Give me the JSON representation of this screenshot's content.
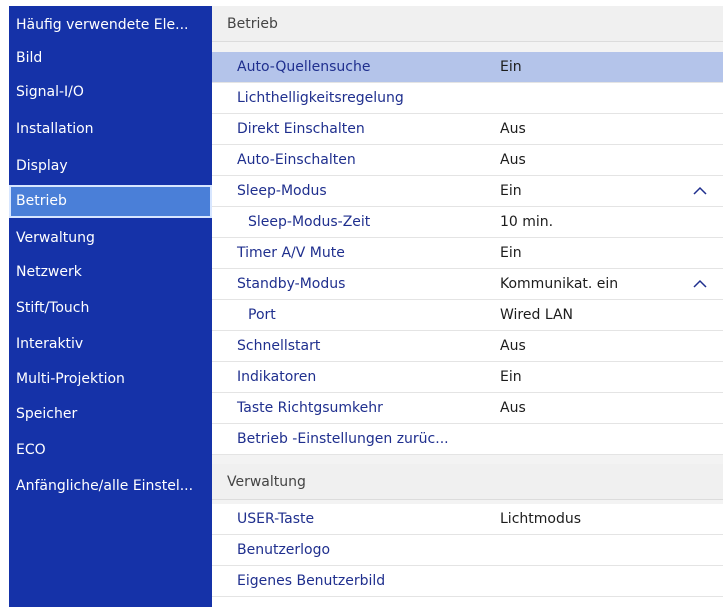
{
  "sidebar": {
    "items": [
      {
        "label": "Häufig verwendete Ele...",
        "selected": false
      },
      {
        "label": "Bild",
        "selected": false
      },
      {
        "label": "Signal-I/O",
        "selected": false
      },
      {
        "label": "Installation",
        "selected": false
      },
      {
        "label": "Display",
        "selected": false
      },
      {
        "label": "Betrieb",
        "selected": true
      },
      {
        "label": "Verwaltung",
        "selected": false
      },
      {
        "label": "Netzwerk",
        "selected": false
      },
      {
        "label": "Stift/Touch",
        "selected": false
      },
      {
        "label": "Interaktiv",
        "selected": false
      },
      {
        "label": "Multi-Projektion",
        "selected": false
      },
      {
        "label": "Speicher",
        "selected": false
      },
      {
        "label": "ECO",
        "selected": false
      },
      {
        "label": "Anfängliche/alle Einstel...",
        "selected": false
      }
    ]
  },
  "sections": {
    "betrieb": {
      "title": "Betrieb",
      "rows": [
        {
          "label": "Auto-Quellensuche",
          "value": "Ein",
          "highlighted": true
        },
        {
          "label": "Lichthelligkeitsregelung",
          "value": ""
        },
        {
          "label": "Direkt Einschalten",
          "value": "Aus"
        },
        {
          "label": "Auto-Einschalten",
          "value": "Aus"
        },
        {
          "label": "Sleep-Modus",
          "value": "Ein",
          "expand_icon": "chevron-up-icon"
        },
        {
          "label": "Sleep-Modus-Zeit",
          "value": "10 min.",
          "indented": true
        },
        {
          "label": "Timer A/V Mute",
          "value": "Ein"
        },
        {
          "label": "Standby-Modus",
          "value": "Kommunikat. ein",
          "expand_icon": "chevron-up-icon"
        },
        {
          "label": "Port",
          "value": "Wired LAN",
          "indented": true
        },
        {
          "label": "Schnellstart",
          "value": "Aus"
        },
        {
          "label": "Indikatoren",
          "value": "Ein"
        },
        {
          "label": "Taste Richtgsumkehr",
          "value": "Aus"
        },
        {
          "label": "Betrieb -Einstellungen zurüc...",
          "value": ""
        }
      ]
    },
    "verwaltung": {
      "title": "Verwaltung",
      "rows": [
        {
          "label": "USER-Taste",
          "value": "Lichtmodus"
        },
        {
          "label": "Benutzerlogo",
          "value": ""
        },
        {
          "label": "Eigenes Benutzerbild",
          "value": ""
        }
      ]
    }
  },
  "colors": {
    "sidebar_bg": "#1532a8",
    "sidebar_selected": "#4a7fd8",
    "row_highlight": "#b4c4ea",
    "item_text": "#1f2f8e"
  }
}
